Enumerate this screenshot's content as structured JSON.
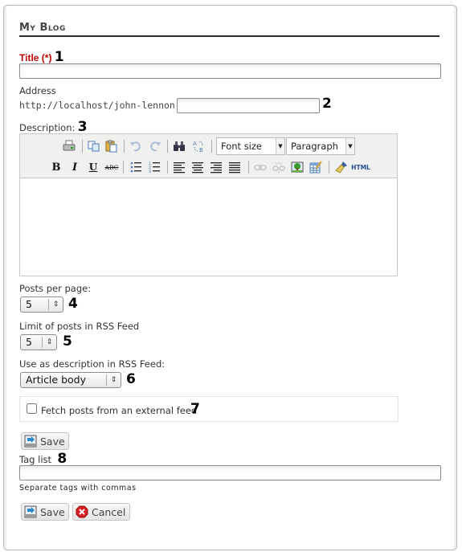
{
  "page": {
    "heading": "My Blog"
  },
  "form": {
    "title": {
      "label": "Title (*)",
      "annotation": "1",
      "value": ""
    },
    "address": {
      "label": "Address",
      "prefix": "http://localhost/john-lennon",
      "value": "",
      "annotation": "2"
    },
    "description": {
      "label": "Description:",
      "annotation": "3",
      "toolbar": {
        "row1": [
          "print-icon",
          "copy-icon",
          "paste-icon",
          "undo-icon",
          "redo-icon",
          "find-icon",
          "replace-icon"
        ],
        "font_size": "Font size",
        "format": "Paragraph",
        "row2": [
          "bold-icon",
          "italic-icon",
          "underline-icon",
          "strikethrough-icon",
          "bullet-list-icon",
          "numbered-list-icon",
          "align-left-icon",
          "align-center-icon",
          "align-right-icon",
          "align-justify-icon",
          "link-icon",
          "unlink-icon",
          "image-icon",
          "table-icon",
          "cleanup-icon",
          "html-icon"
        ],
        "html_label": "HTML"
      },
      "content": ""
    },
    "posts_per_page": {
      "label": "Posts per page:",
      "value": "5",
      "annotation": "4"
    },
    "rss_limit": {
      "label": "Limit of posts in RSS Feed",
      "value": "5",
      "annotation": "5"
    },
    "rss_description": {
      "label": "Use as description in RSS Feed:",
      "value": "Article body",
      "annotation": "6"
    },
    "external_feed": {
      "label": "Fetch posts from an external feed",
      "checked": false,
      "annotation": "7"
    },
    "save_label": "Save",
    "tags": {
      "label": "Tag list",
      "annotation": "8",
      "value": "",
      "hint": "Separate tags with commas"
    },
    "footer": {
      "save_label": "Save",
      "cancel_label": "Cancel"
    }
  },
  "colors": {
    "required": "#c00000",
    "heading_rule": "#2a2e30"
  }
}
